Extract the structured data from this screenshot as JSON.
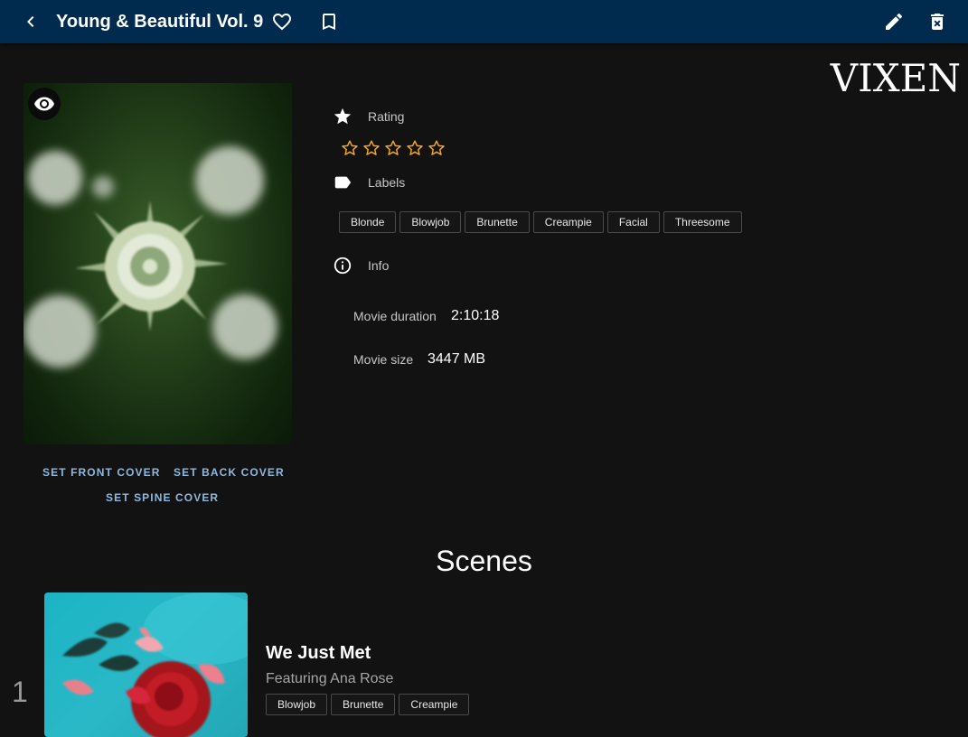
{
  "appbar": {
    "title": "Young & Beautiful Vol. 9",
    "icons": {
      "back": "chevron-left-icon",
      "favorite": "heart-outline-icon",
      "bookmark": "bookmark-outline-icon",
      "edit": "pencil-icon",
      "delete": "delete-icon"
    }
  },
  "cover": {
    "actions": [
      "Set front cover",
      "Set back cover",
      "Set spine cover"
    ]
  },
  "studio": {
    "logo": "VIXEN"
  },
  "rating": {
    "label": "Rating",
    "value": 0,
    "max": 5,
    "star_color": "#f5a623"
  },
  "labels": {
    "label": "Labels",
    "items": [
      "Blonde",
      "Blowjob",
      "Brunette",
      "Creampie",
      "Facial",
      "Threesome"
    ]
  },
  "info": {
    "label": "Info",
    "duration_label": "Movie duration",
    "duration": "2:10:18",
    "size_label": "Movie size",
    "size": "3447 MB"
  },
  "scenes": {
    "heading": "Scenes",
    "items": [
      {
        "number": "1",
        "title": "We Just Met",
        "featuring": "Featuring Ana Rose",
        "labels": [
          "Blowjob",
          "Brunette",
          "Creampie"
        ]
      }
    ]
  },
  "colors": {
    "appbar": "#002b4f",
    "background": "#121212",
    "link": "#8fb8de"
  }
}
